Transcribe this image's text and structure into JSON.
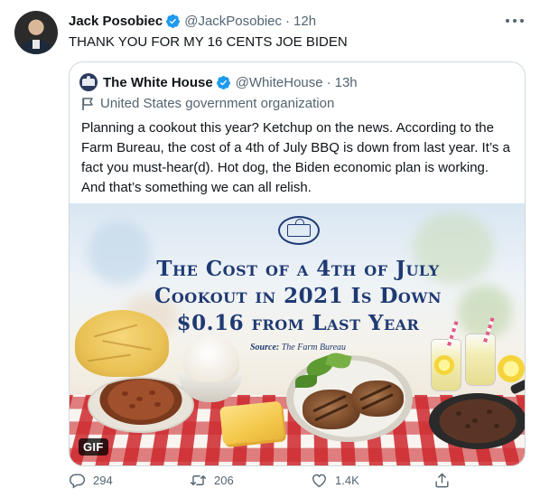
{
  "tweet": {
    "author_name": "Jack Posobiec",
    "author_handle": "@JackPosobiec",
    "separator": "·",
    "time": "12h",
    "text": "THANK YOU FOR MY 16 CENTS JOE BIDEN",
    "more_icon": "more-dots-icon",
    "verified_icon": "verified-badge-icon"
  },
  "quote": {
    "author_name": "The White House",
    "author_handle": "@WhiteHouse",
    "separator": "·",
    "time": "13h",
    "org_label": "United States government organization",
    "org_icon": "flag-icon",
    "text": "Planning a cookout this year? Ketchup on the news. According to the Farm Bureau, the cost of a 4th of July BBQ is down from last year. It’s a fact you must-hear(d). Hot dog, the Biden economic plan is working. And that’s something we can all relish.",
    "media": {
      "headline_line1": "The Cost of a 4th of July",
      "headline_line2": "Cookout in 2021 Is Down",
      "headline_line3": "$0.16 from Last Year",
      "source_label": "Source:",
      "source_value": "The Farm Bureau",
      "badge": "GIF"
    }
  },
  "actions": {
    "reply_count": "294",
    "retweet_count": "206",
    "like_count": "1.4K",
    "reply_icon": "reply-icon",
    "retweet_icon": "retweet-icon",
    "like_icon": "heart-icon",
    "share_icon": "share-icon"
  },
  "colors": {
    "text_primary": "#0f1419",
    "text_secondary": "#536471",
    "verified_blue": "#1d9bf0",
    "border": "#cfd9de",
    "headline_navy": "#1f3a73"
  }
}
